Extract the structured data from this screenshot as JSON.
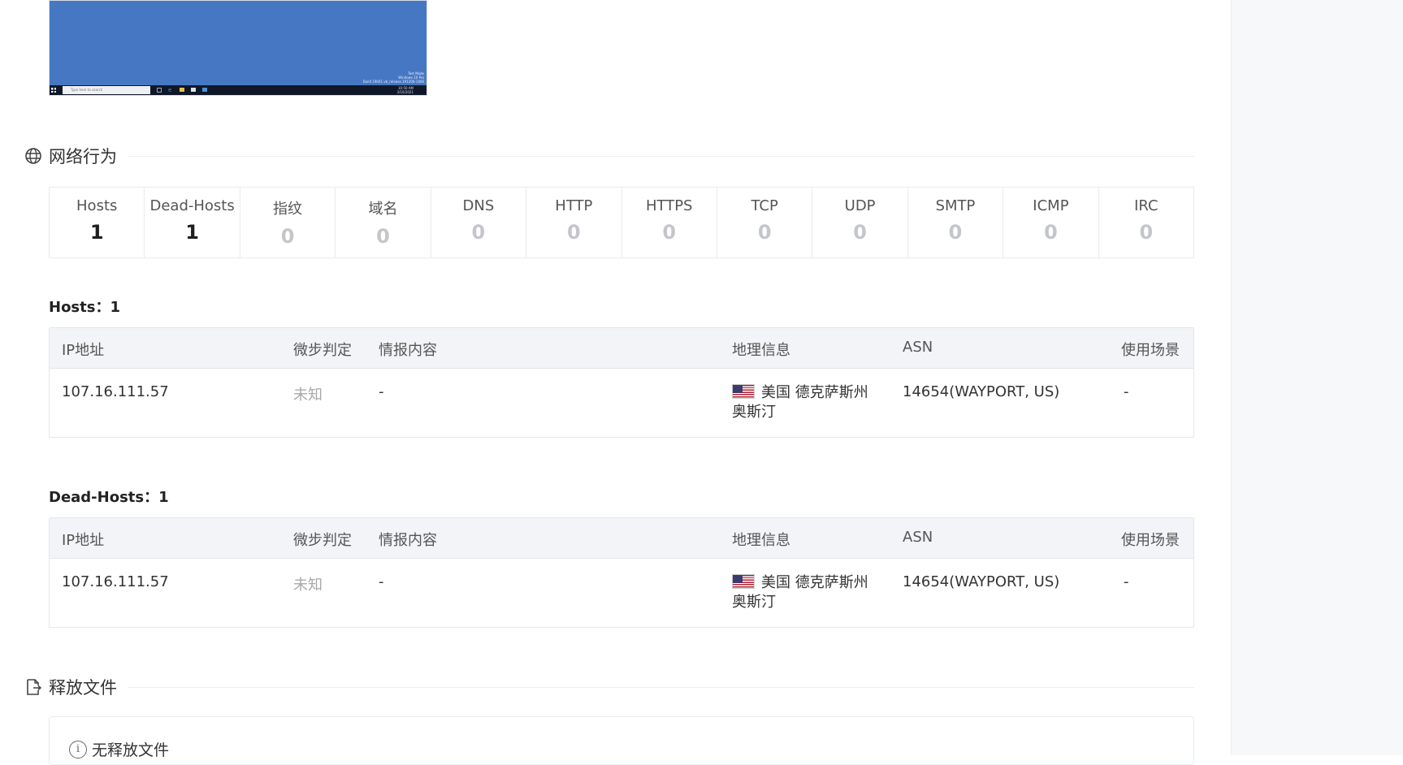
{
  "thumbnail": {
    "desktop_text": [
      "Test Mode",
      "Windows 10 Pro",
      "Build 19041.vb_release.191206-1406"
    ],
    "taskbar_search": "Type here to search",
    "taskbar_clock": [
      "10:50 AM",
      "3/10/2021"
    ]
  },
  "network": {
    "title": "网络行为",
    "stats": [
      {
        "label": "Hosts",
        "value": "1"
      },
      {
        "label": "Dead-Hosts",
        "value": "1"
      },
      {
        "label": "指纹",
        "value": "0"
      },
      {
        "label": "域名",
        "value": "0"
      },
      {
        "label": "DNS",
        "value": "0"
      },
      {
        "label": "HTTP",
        "value": "0"
      },
      {
        "label": "HTTPS",
        "value": "0"
      },
      {
        "label": "TCP",
        "value": "0"
      },
      {
        "label": "UDP",
        "value": "0"
      },
      {
        "label": "SMTP",
        "value": "0"
      },
      {
        "label": "ICMP",
        "value": "0"
      },
      {
        "label": "IRC",
        "value": "0"
      }
    ]
  },
  "columns": {
    "ip": "IP地址",
    "verdict": "微步判定",
    "intel": "情报内容",
    "geo": "地理信息",
    "asn": "ASN",
    "usage": "使用场景"
  },
  "hosts": {
    "title": "Hosts：1",
    "rows": [
      {
        "ip": "107.16.111.57",
        "verdict": "未知",
        "intel": "-",
        "geo": "美国 德克萨斯州 奥斯汀",
        "asn": "14654(WAYPORT, US)",
        "usage": "-"
      }
    ]
  },
  "dead_hosts": {
    "title": "Dead-Hosts：1",
    "rows": [
      {
        "ip": "107.16.111.57",
        "verdict": "未知",
        "intel": "-",
        "geo": "美国 德克萨斯州 奥斯汀",
        "asn": "14654(WAYPORT, US)",
        "usage": "-"
      }
    ]
  },
  "released_files": {
    "title": "释放文件",
    "empty_text": "无释放文件"
  }
}
